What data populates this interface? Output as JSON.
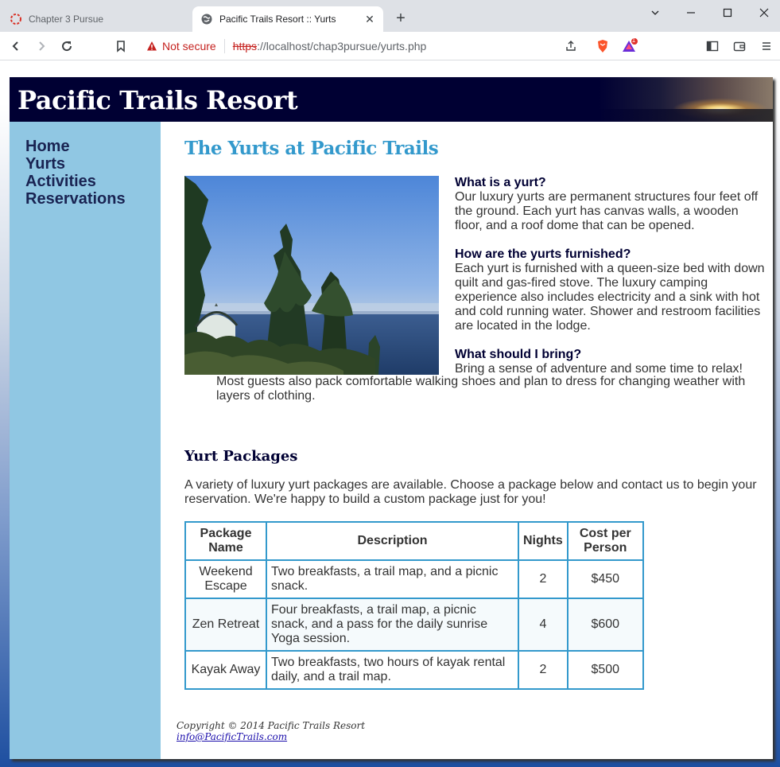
{
  "browser": {
    "tabs": [
      {
        "title": "Chapter 3 Pursue",
        "active": false
      },
      {
        "title": "Pacific Trails Resort :: Yurts",
        "active": true
      }
    ],
    "new_tab_icon": "plus-icon",
    "security_label": "Not secure",
    "url_scheme": "https",
    "url_rest": "://localhost/chap3pursue/yurts.php",
    "brave_badge": "1"
  },
  "site": {
    "title": "Pacific Trails Resort",
    "nav": [
      "Home",
      "Yurts",
      "Activities",
      "Reservations"
    ],
    "heading": "The Yurts at Pacific Trails",
    "faq": [
      {
        "q": "What is a yurt?",
        "a": "Our luxury yurts are permanent structures four feet off the ground. Each yurt has canvas walls, a wooden floor, and a roof dome that can be opened."
      },
      {
        "q": "How are the yurts furnished?",
        "a": "Each yurt is furnished with a queen-size bed with down quilt and gas-fired stove. The luxury camping experience also includes electricity and a sink with hot and cold running water. Shower and restroom facilities are located in the lodge."
      },
      {
        "q": "What should I bring?",
        "a_line1": "Bring a sense of adventure and some time to relax!",
        "a_rest": "Most guests also pack comfortable walking shoes and plan to dress for changing weather with layers of clothing."
      }
    ],
    "packages_heading": "Yurt Packages",
    "packages_intro": "A variety of luxury yurt packages are available. Choose a package below and contact us to begin your reservation. We're happy to build a custom package just for you!",
    "table": {
      "headers": [
        "Package Name",
        "Description",
        "Nights",
        "Cost per Person"
      ],
      "rows": [
        {
          "name": "Weekend Escape",
          "description": "Two breakfasts, a trail map, and a picnic snack.",
          "nights": "2",
          "cost": "$450"
        },
        {
          "name": "Zen Retreat",
          "description": "Four breakfasts, a trail map, a picnic snack, and a pass for the daily sunrise Yoga session.",
          "nights": "4",
          "cost": "$600"
        },
        {
          "name": "Kayak Away",
          "description": "Two breakfasts, two hours of kayak rental daily, and a trail map.",
          "nights": "2",
          "cost": "$500"
        }
      ]
    },
    "footer": {
      "copyright": "Copyright © 2014 Pacific Trails Resort",
      "email": "info@PacificTrails.com"
    }
  }
}
